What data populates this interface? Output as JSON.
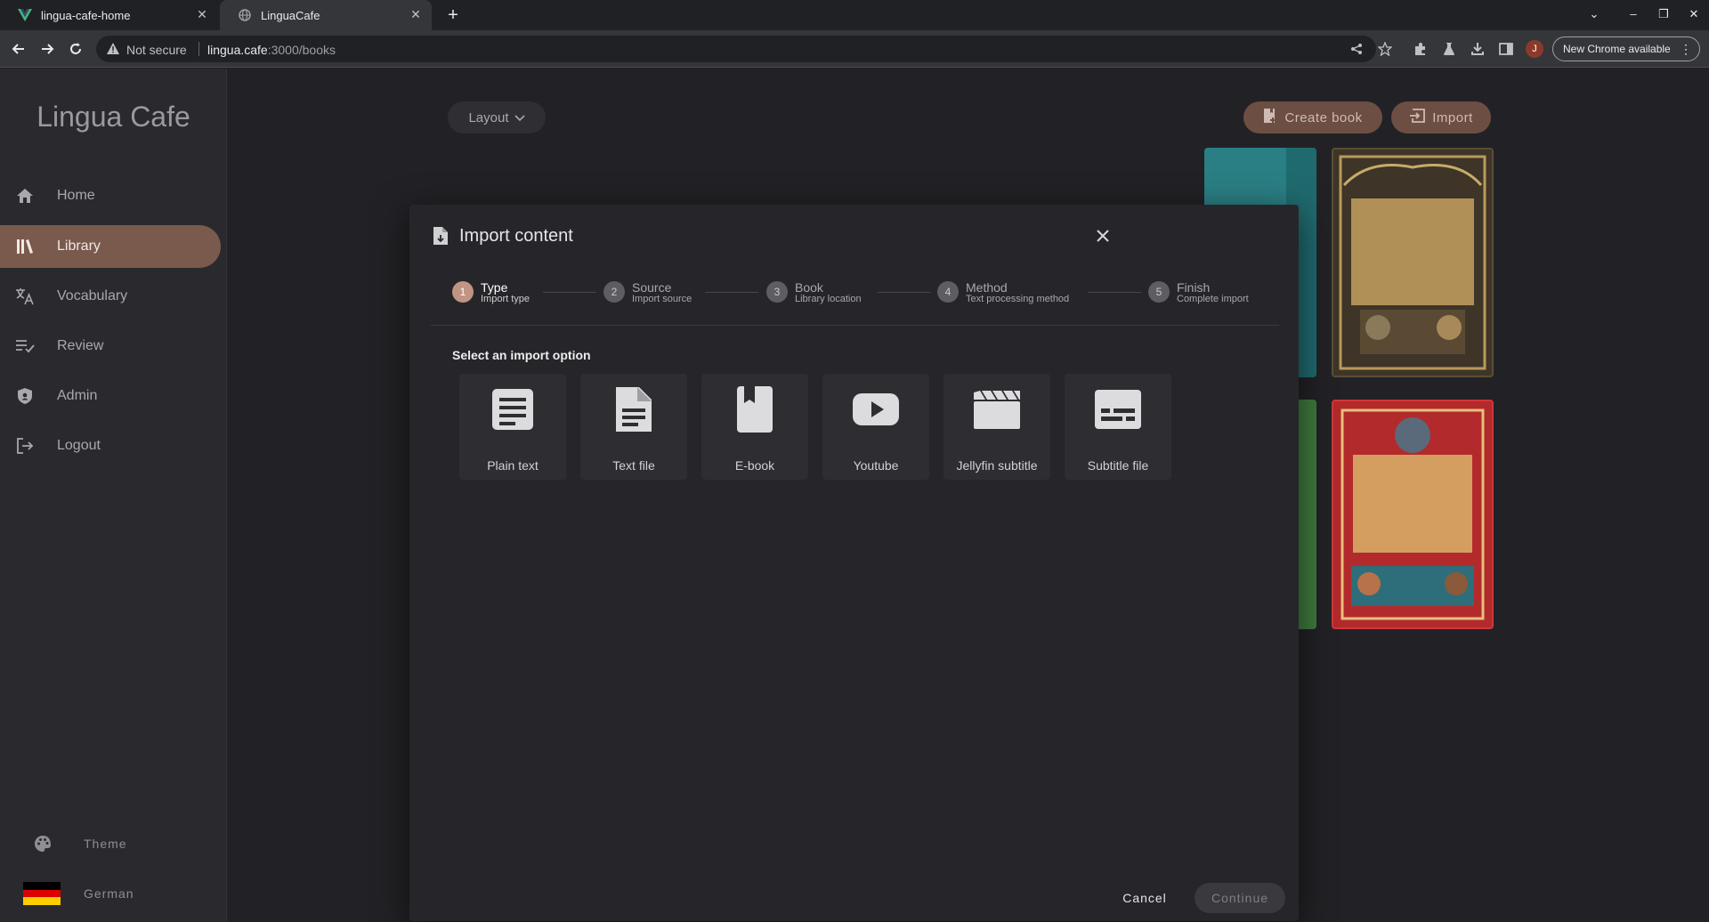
{
  "browser": {
    "tabs": [
      {
        "title": "lingua-cafe-home",
        "active": false,
        "favicon": "vue-logo-icon"
      },
      {
        "title": "LinguaCafe",
        "active": true,
        "favicon": "globe-icon"
      }
    ],
    "security_label": "Not secure",
    "url_host": "lingua.cafe",
    "url_path": ":3000/books",
    "avatar_letter": "J",
    "update_label": "New Chrome available"
  },
  "sidebar": {
    "brand": "Lingua Cafe",
    "items": [
      {
        "label": "Home",
        "icon": "home-icon",
        "active": false
      },
      {
        "label": "Library",
        "icon": "library-icon",
        "active": true
      },
      {
        "label": "Vocabulary",
        "icon": "translate-icon",
        "active": false
      },
      {
        "label": "Review",
        "icon": "review-icon",
        "active": false
      },
      {
        "label": "Admin",
        "icon": "shield-icon",
        "active": false
      },
      {
        "label": "Logout",
        "icon": "logout-icon",
        "active": false
      }
    ],
    "theme_label": "Theme",
    "language_label": "German"
  },
  "library": {
    "layout_label": "Layout",
    "create_book_label": "Create book",
    "import_label": "Import"
  },
  "dialog": {
    "title": "Import content",
    "steps": [
      {
        "num": "1",
        "title": "Type",
        "subtitle": "Import type",
        "active": true
      },
      {
        "num": "2",
        "title": "Source",
        "subtitle": "Import source",
        "active": false
      },
      {
        "num": "3",
        "title": "Book",
        "subtitle": "Library location",
        "active": false
      },
      {
        "num": "4",
        "title": "Method",
        "subtitle": "Text processing method",
        "active": false
      },
      {
        "num": "5",
        "title": "Finish",
        "subtitle": "Complete import",
        "active": false
      }
    ],
    "select_label": "Select an import option",
    "options": [
      {
        "label": "Plain text",
        "icon": "text-box-icon"
      },
      {
        "label": "Text file",
        "icon": "file-document-icon"
      },
      {
        "label": "E-book",
        "icon": "book-icon"
      },
      {
        "label": "Youtube",
        "icon": "youtube-icon"
      },
      {
        "label": "Jellyfin subtitle",
        "icon": "clapperboard-icon"
      },
      {
        "label": "Subtitle file",
        "icon": "subtitles-icon"
      }
    ],
    "cancel_label": "Cancel",
    "continue_label": "Continue"
  },
  "colors": {
    "accent": "#7a5a4c",
    "step_active": "#c29483",
    "background": "#222226"
  }
}
